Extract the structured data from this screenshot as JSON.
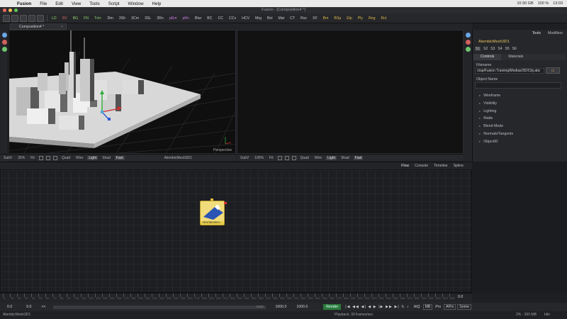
{
  "menubar": {
    "app": "Fusion",
    "items": [
      "File",
      "Edit",
      "View",
      "Tools",
      "Script",
      "Window",
      "Help"
    ],
    "clock": "10:30 GB",
    "battery": "100 %",
    "time": "13:03"
  },
  "window": {
    "title": "Fusion - [Composition4 *]"
  },
  "toolbar": {
    "buttons": [
      "LD",
      "SV",
      "BG",
      "FN",
      "Txt+",
      "3Im",
      "3Sh",
      "3Cm",
      "3SL",
      "3Rn",
      "pEm",
      "pRn",
      "Blur",
      "BC",
      "CC",
      "CCv",
      "HCV",
      "Mrg",
      "Bol",
      "Mat",
      "CT",
      "Rsz",
      "XF",
      "Bm",
      "BSp",
      "Elp",
      "Ply",
      "Rng",
      "Rct"
    ]
  },
  "tab": {
    "label": "Composition4 *",
    "close": "×"
  },
  "viewer1": {
    "overlay": "Perspective",
    "bar": {
      "subv": "SubV",
      "zoom": "35%",
      "fit": "Fit",
      "quad": "Quad",
      "wire": "Wire",
      "light": "Light",
      "shad": "Shad",
      "fast": "Fast",
      "node": "AlembicMesh3D1"
    }
  },
  "viewer2": {
    "bar": {
      "subv": "SubV",
      "zoom": "100%",
      "fit": "Fit",
      "quad": "Quad",
      "wire": "Wire",
      "light": "Light",
      "shad": "Shad",
      "fast": "Fast"
    }
  },
  "rightpanel": {
    "tabs": [
      "Tools",
      "Modifiers"
    ],
    "node_name": "AlembicMesh3D1",
    "versions": [
      "S1",
      "S2",
      "S3",
      "S4",
      "S5",
      "S6"
    ],
    "subtabs": [
      "Controls",
      "Materials"
    ],
    "filename_label": "Filename",
    "filename_value": "ctop/Fusion Training/Medias/3D/City.abc",
    "browse_icon": "folder-icon",
    "objname_label": "Object Name",
    "props": [
      "Wireframe",
      "Visibility",
      "Lighting",
      "Matte",
      "Blend Mode",
      "Normals/Tangents",
      "ObjectID"
    ]
  },
  "nodeeditor": {
    "tabs": [
      "Flow",
      "Console",
      "Timeline",
      "Spline"
    ],
    "node_label": "AlembicMes..."
  },
  "timeline": {
    "ticks": [
      "0",
      "10",
      "20",
      "30",
      "40",
      "50",
      "60",
      "70",
      "80",
      "90",
      "100",
      "110",
      "120",
      "130",
      "140",
      "150",
      "160",
      "170",
      "180",
      "190",
      "200",
      "210",
      "220",
      "230",
      "240",
      "250",
      "260",
      "270",
      "280",
      "290",
      "300",
      "310",
      "320",
      "330",
      "340",
      "350",
      "360",
      "370",
      "380",
      "390",
      "400",
      "410",
      "420",
      "430",
      "440",
      "450",
      "460",
      "470",
      "480",
      "490",
      "500",
      "510",
      "520",
      "530",
      "540",
      "550",
      "560",
      "570",
      "580",
      "590",
      "600",
      "610",
      "620",
      "630"
    ],
    "current": "0.0",
    "start": "0.0",
    "render_start": "0.0",
    "prev": "<<",
    "slider_end": "1000",
    "end": "1000.0",
    "render_end": "1000.0",
    "render_btn": "Render",
    "hiq": "HiQ",
    "mb": "MB",
    "prx": "Prx",
    "aprx": "APrx",
    "some": "Some"
  },
  "status": {
    "left": "AlembicMesh3D1",
    "playback": "Playback: 30 frames/sec",
    "memory": "2% - 360 MB",
    "state": "Idle"
  },
  "colors": {
    "accent": "#e6c35a",
    "node": "#e8cf4a",
    "render_btn": "#2c7a3c"
  }
}
